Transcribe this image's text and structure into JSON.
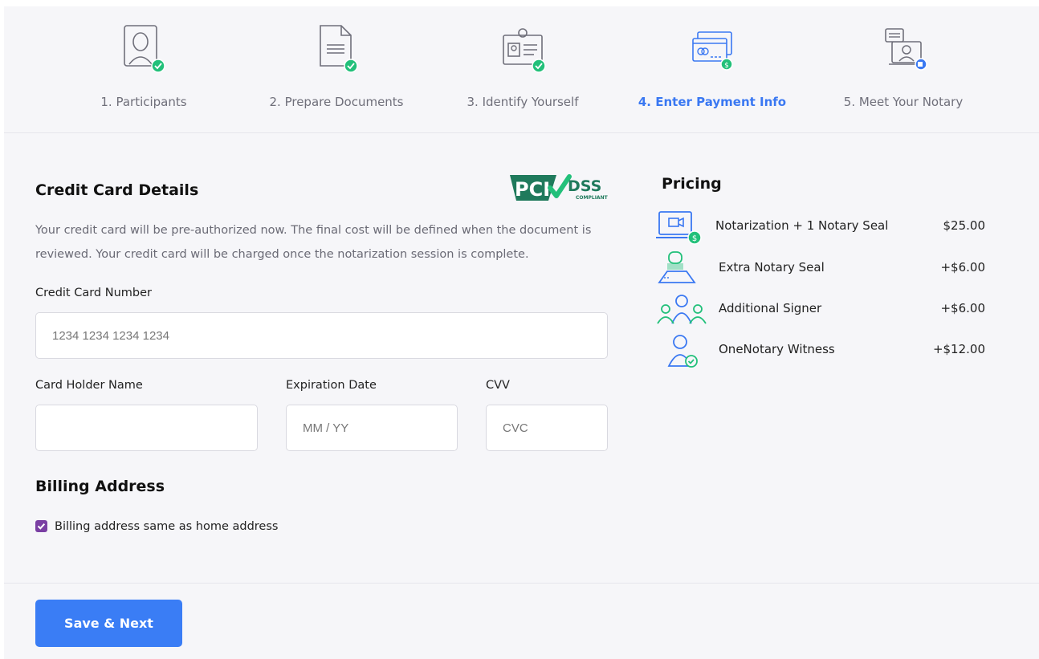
{
  "stepper": {
    "steps": [
      {
        "label": "1. Participants",
        "icon": "participant-portrait-icon",
        "completed": true
      },
      {
        "label": "2. Prepare Documents",
        "icon": "document-icon",
        "completed": true
      },
      {
        "label": "3. Identify Yourself",
        "icon": "id-badge-icon",
        "completed": true
      },
      {
        "label": "4. Enter Payment Info",
        "icon": "credit-card-payment-icon",
        "active": true
      },
      {
        "label": "5. Meet Your Notary",
        "icon": "video-meeting-icon",
        "completed": false
      }
    ]
  },
  "credit_card": {
    "title": "Credit Card Details",
    "pci_logo": {
      "text_pci": "PCI",
      "text_dss": "DSS",
      "text_compliant": "COMPLIANT"
    },
    "description": "Your credit card will be pre-authorized now. The final cost will be defined when the document is reviewed. Your credit card will be charged once the notarization session is complete.",
    "card_number_label": "Credit Card Number",
    "card_number_placeholder": "1234 1234 1234 1234",
    "holder_label": "Card Holder Name",
    "holder_value": "",
    "expiry_label": "Expiration Date",
    "expiry_placeholder": "MM / YY",
    "cvv_label": "CVV",
    "cvv_placeholder": "CVC"
  },
  "billing": {
    "title": "Billing Address",
    "same_as_home_label": "Billing address same as home address",
    "same_as_home_checked": true
  },
  "pricing": {
    "title": "Pricing",
    "items": [
      {
        "name": "Notarization + 1 Notary Seal",
        "price": "$25.00",
        "icon": "laptop-video-dollar-icon"
      },
      {
        "name": "Extra Notary Seal",
        "price": "+$6.00",
        "icon": "notary-stamp-icon"
      },
      {
        "name": "Additional Signer",
        "price": "+$6.00",
        "icon": "group-signers-icon"
      },
      {
        "name": "OneNotary Witness",
        "price": "+$12.00",
        "icon": "witness-person-check-icon"
      }
    ]
  },
  "footer": {
    "save_button_label": "Save & Next"
  },
  "colors": {
    "accent": "#3a7df5",
    "success": "#22c07a",
    "checkbox": "#7a3fa3",
    "pci_green": "#1f7a5c"
  }
}
